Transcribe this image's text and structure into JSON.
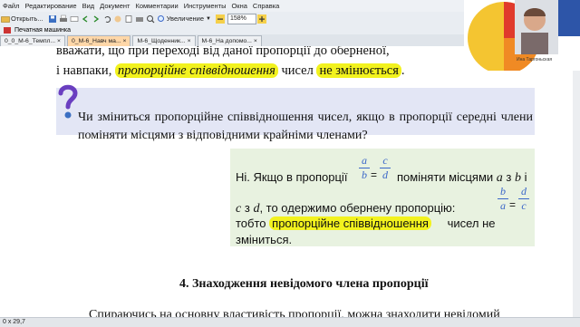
{
  "menu": [
    "Файл",
    "Редактирование",
    "Вид",
    "Документ",
    "Комментарии",
    "Инструменты",
    "Окна",
    "Справка"
  ],
  "toolbar": {
    "open_label": "Открыть...",
    "zoom_mode": "Увеличение",
    "zoom_value": "158%"
  },
  "subtool": {
    "typewriter_label": "Печатная машинка"
  },
  "tabs": [
    {
      "label": "0_0_М-6_Темпл..."
    },
    {
      "label": "0_М-6_Навч ма..."
    },
    {
      "label": "М-6_Щоденник..."
    },
    {
      "label": "М-6_На допомо..."
    }
  ],
  "document": {
    "line1": "вважати, що при переході від даної пропорції до оберненої,",
    "line2_pre": "і навпаки,",
    "line2_hl": "пропорційне співвідношення",
    "line2_mid": "чисел",
    "line2_hl2": "не змінюється",
    "line2_end": ".",
    "question": "Чи зміниться пропорційне співвідношення чисел, якщо в пропорції середні члени поміняти місцями з відповідними крайніми членами?",
    "answer": {
      "l1_a": "Ні. Якщо в пропорції",
      "l1_b": "поміняти місцями",
      "l1_c": "з",
      "l1_d": "і",
      "var_a": "a",
      "var_b": "b",
      "var_c": "c",
      "var_d": "d",
      "l2_a": "з",
      "l2_b": ", то одержимо обернену пропорцію:",
      "l3_a": "тобто",
      "l3_hl": "пропорційне співвідношення",
      "l3_b": "чисел не",
      "l4": "зміниться.",
      "eq": "="
    },
    "heading": "4. Знаходження невідомого члена пропорції",
    "bottom": "Спираючись на основну властивість пропорції, можна знаходити невідомий"
  },
  "status": {
    "size": "0 x 29,7"
  },
  "video": {
    "caption": "Ина Таргоньская"
  },
  "colors": {
    "highlight": "#f2f21e",
    "question_bg": "#e3e6f5",
    "answer_bg": "#e8f2e0",
    "fraction": "#3a66c8",
    "active_tab": "#ffd7a8"
  }
}
